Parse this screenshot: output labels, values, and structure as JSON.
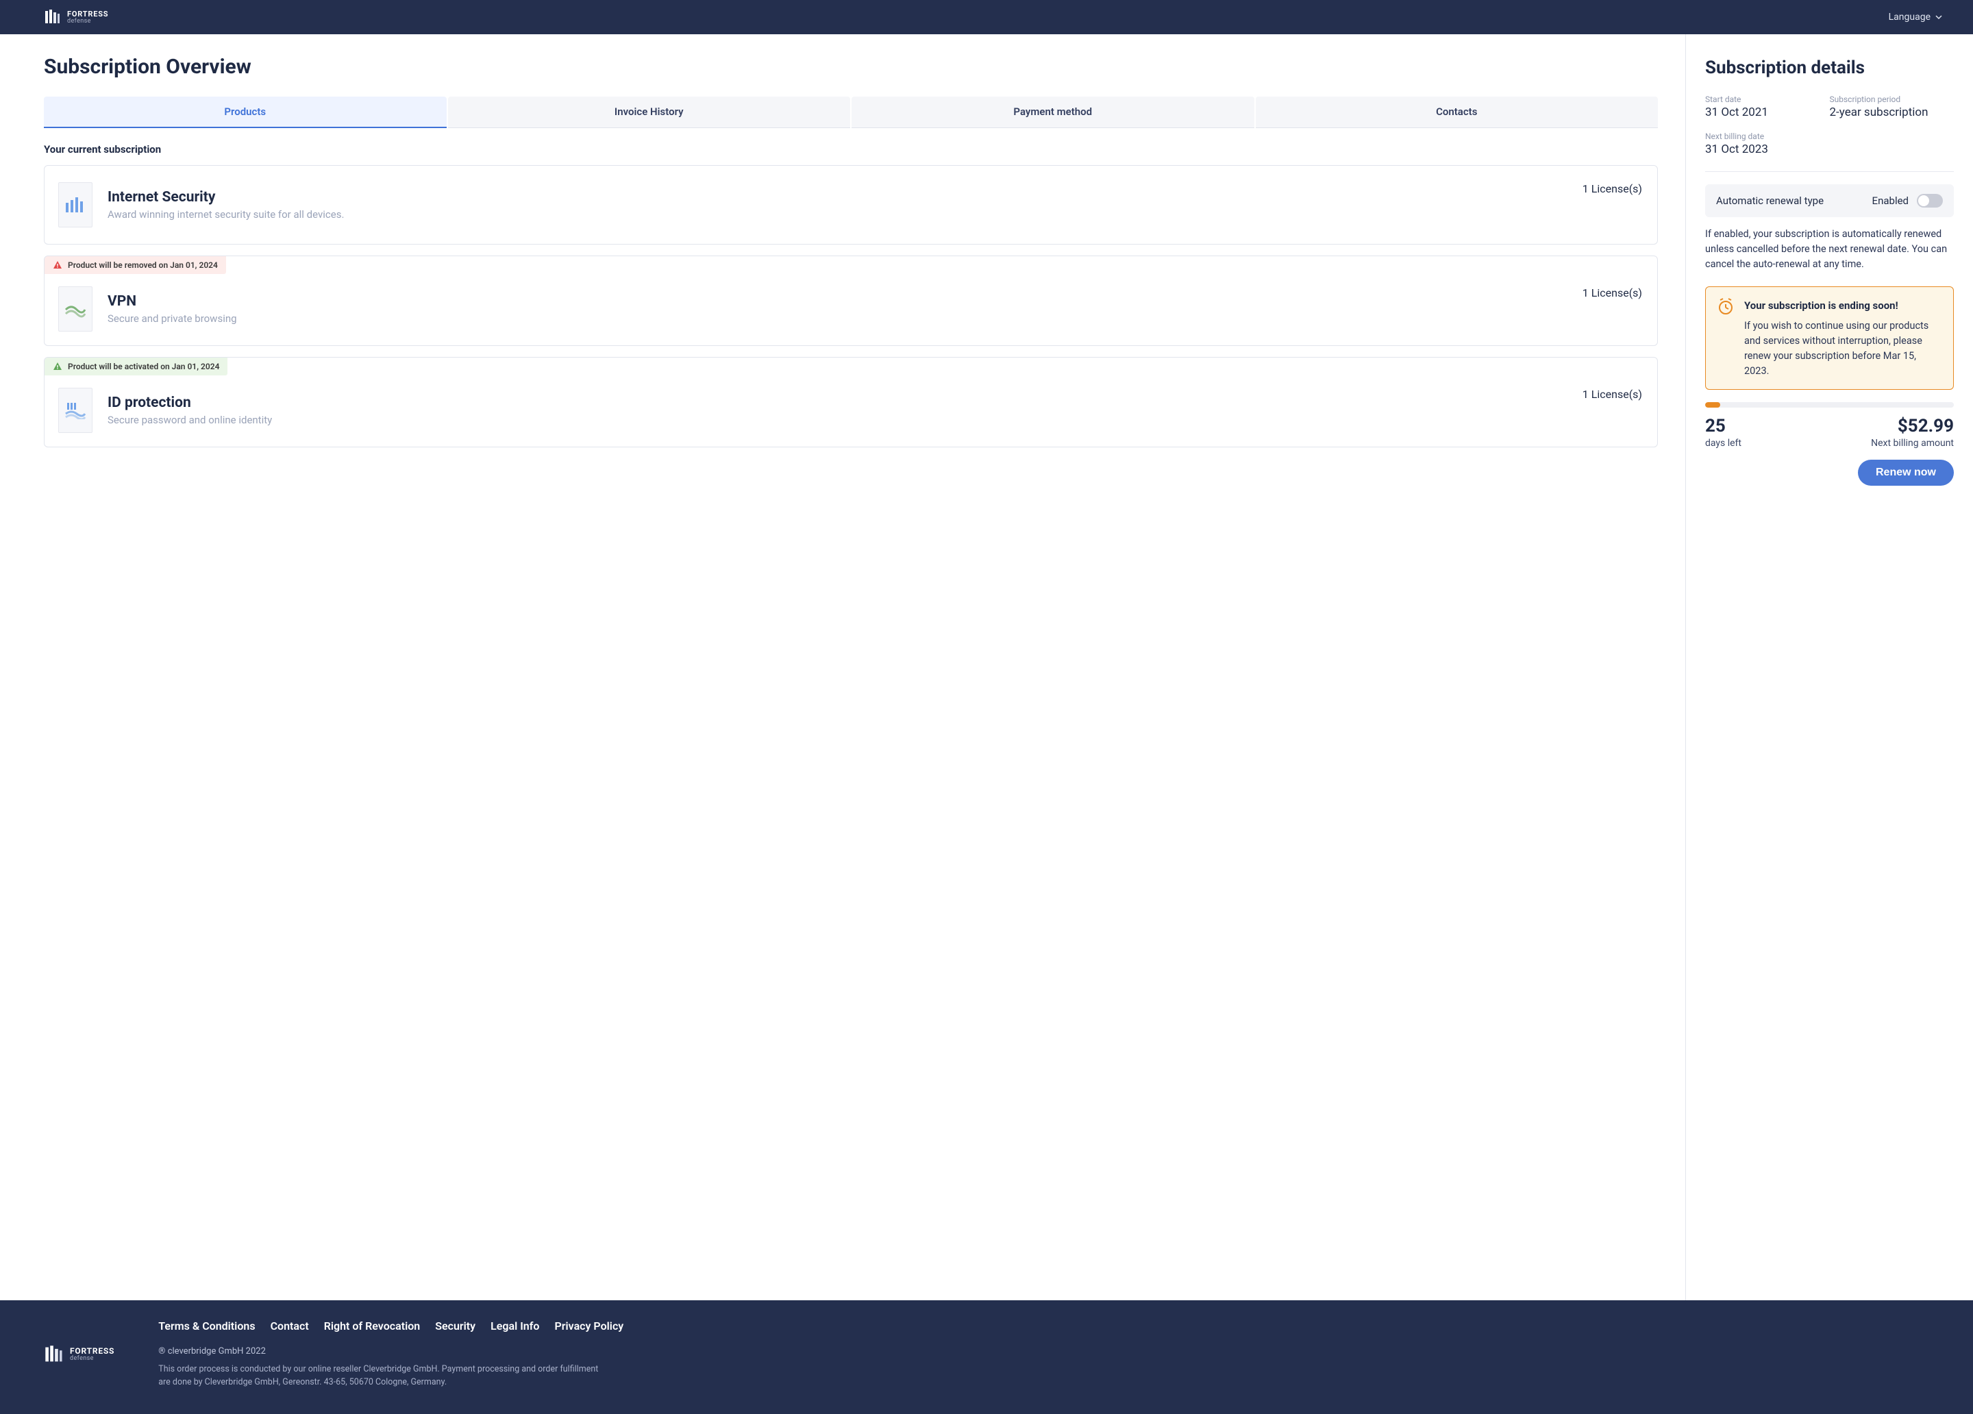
{
  "header": {
    "brand_top": "FORTRESS",
    "brand_sub": "defense",
    "language": "Language"
  },
  "title": "Subscription Overview",
  "tabs": [
    {
      "label": "Products",
      "active": true
    },
    {
      "label": "Invoice History",
      "active": false
    },
    {
      "label": "Payment method",
      "active": false
    },
    {
      "label": "Contacts",
      "active": false
    }
  ],
  "products_heading": "Your current subscription",
  "products": [
    {
      "name": "Internet Security",
      "desc": "Award winning internet security suite for all devices.",
      "licenses": "1 License(s)"
    },
    {
      "banner": "Product will be removed on Jan 01, 2024",
      "banner_kind": "warn",
      "name": "VPN",
      "desc": "Secure and private browsing",
      "licenses": "1 License(s)"
    },
    {
      "banner": "Product will be activated on Jan 01, 2024",
      "banner_kind": "ok",
      "name": "ID protection",
      "desc": "Secure password and online identity",
      "licenses": "1 License(s)"
    }
  ],
  "details": {
    "title": "Subscription details",
    "start_date_label": "Start date",
    "start_date": "31 Oct 2021",
    "period_label": "Subscription period",
    "period": "2-year subscription",
    "next_billing_label": "Next billing date",
    "next_billing": "31 Oct 2023",
    "renewal_type_label": "Automatic renewal type",
    "renewal_state": "Enabled",
    "renewal_note": "If enabled, your subscription is automatically renewed unless cancelled before the next renewal date. You can cancel the auto-renewal at any time.",
    "alert_title": "Your subscription is ending soon!",
    "alert_text": "If you wish to continue using our products and services without interruption, please renew your subscription before Mar 15, 2023.",
    "progress_pct": 6,
    "days_left": "25",
    "days_left_label": "days left",
    "amount": "$52.99",
    "amount_label": "Next billing amount",
    "renew_button": "Renew now"
  },
  "footer": {
    "links": [
      "Terms & Conditions",
      "Contact",
      "Right of Revocation",
      "Security",
      "Legal Info",
      "Privacy Policy"
    ],
    "copyright": "® cleverbridge GmbH 2022",
    "legal": "This order process is conducted by our online reseller Cleverbridge GmbH. Payment processing and order fulfillment are done by Cleverbridge GmbH, Gereonstr. 43-65, 50670 Cologne, Germany."
  }
}
